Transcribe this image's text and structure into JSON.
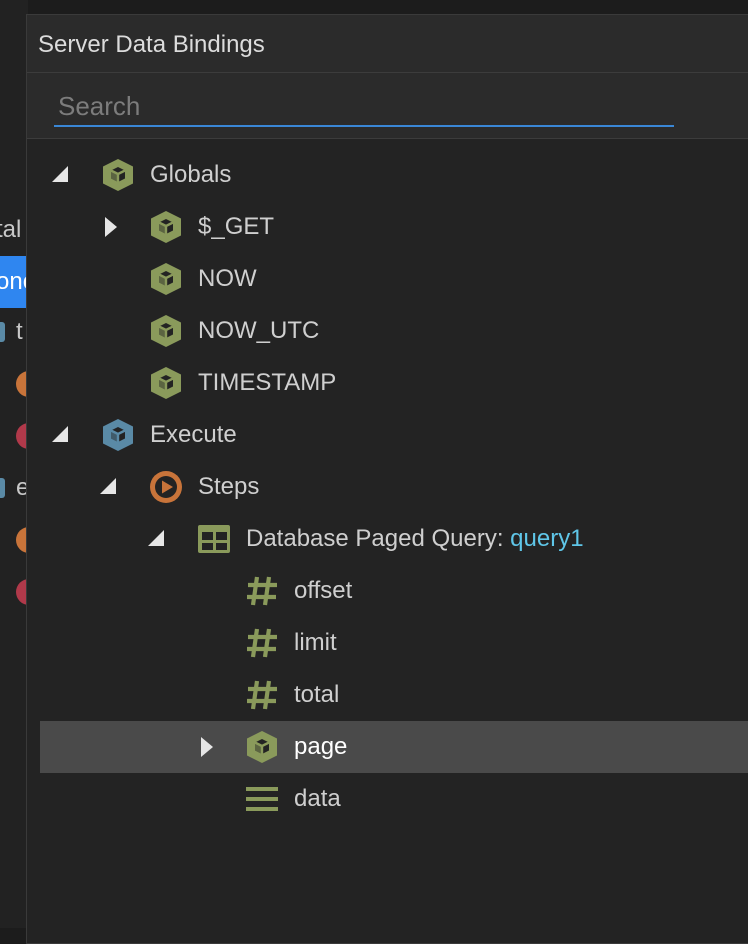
{
  "dialog": {
    "title": "Server Data Bindings",
    "search_placeholder": "Search",
    "search_value": ""
  },
  "background_panel": {
    "fragments": [
      "tal",
      "onc",
      "t",
      "e"
    ]
  },
  "tree": {
    "globals": {
      "label": "Globals",
      "icon": "box-icon"
    },
    "get": {
      "label": "$_GET",
      "icon": "box-icon"
    },
    "now": {
      "label": "NOW",
      "icon": "box-icon"
    },
    "now_utc": {
      "label": "NOW_UTC",
      "icon": "box-icon"
    },
    "timestamp": {
      "label": "TIMESTAMP",
      "icon": "box-icon"
    },
    "execute": {
      "label": "Execute",
      "icon": "box-icon"
    },
    "steps": {
      "label": "Steps",
      "icon": "play-icon"
    },
    "query": {
      "label": "Database Paged Query: ",
      "ref": "query1",
      "icon": "table-icon"
    },
    "offset": {
      "label": "offset",
      "icon": "hash-icon"
    },
    "limit": {
      "label": "limit",
      "icon": "hash-icon"
    },
    "total": {
      "label": "total",
      "icon": "hash-icon"
    },
    "page": {
      "label": "page",
      "icon": "box-icon"
    },
    "data": {
      "label": "data",
      "icon": "list-icon"
    }
  },
  "colors": {
    "accent": "#3a87d6",
    "box_green": "#8a9a5b",
    "box_blue": "#5a8aa6",
    "play_orange": "#c8743a",
    "ref_cyan": "#5fc6e8",
    "selected_row": "#4a4a4a"
  }
}
